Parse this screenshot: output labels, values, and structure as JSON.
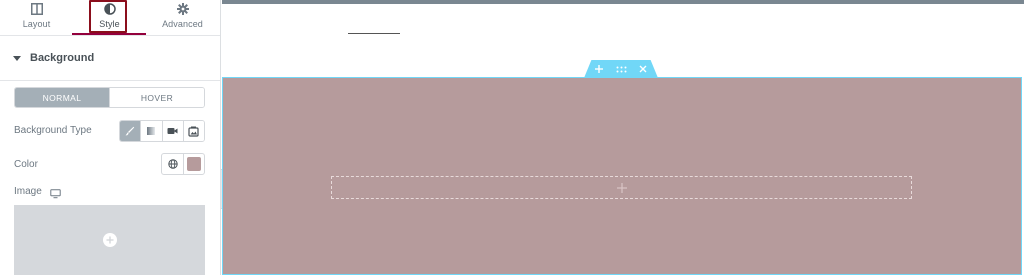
{
  "panel": {
    "tabs": [
      {
        "label": "Layout",
        "icon": "columns-icon"
      },
      {
        "label": "Style",
        "icon": "half-circle-icon"
      },
      {
        "label": "Advanced",
        "icon": "gear-icon"
      }
    ],
    "active_tab": "Style",
    "section": {
      "title": "Background",
      "state_tabs": [
        "NORMAL",
        "HOVER"
      ],
      "active_state": "NORMAL",
      "background_type_label": "Background Type",
      "background_types": [
        "classic-brush-icon",
        "gradient-icon",
        "video-icon",
        "slideshow-icon"
      ],
      "active_background_type": "classic-brush-icon",
      "color_label": "Color",
      "color_value": "#b69b9c",
      "image_label": "Image"
    }
  },
  "canvas": {
    "section_background": "#b69b9c",
    "accent": "#71d7f7",
    "handle_icons": [
      "add-section-icon",
      "drag-handle-icon",
      "delete-section-icon"
    ]
  },
  "colors": {
    "tab_indicator": "#93003c",
    "highlight_box": "#8b0e1c",
    "panel_bg": "#f1f2f3"
  }
}
